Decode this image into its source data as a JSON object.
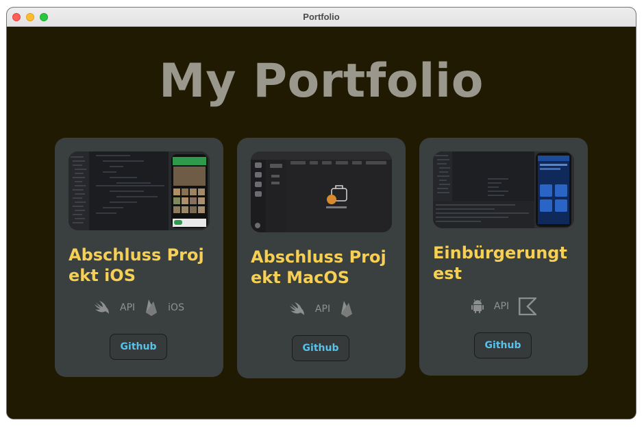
{
  "window": {
    "title": "Portfolio"
  },
  "page": {
    "title": "My Portfolio"
  },
  "projects": [
    {
      "title": "Abschluss Projekt iOS",
      "tech": [
        {
          "icon": "swift-icon"
        },
        {
          "label": "API"
        },
        {
          "icon": "firebase-icon"
        },
        {
          "label": "iOS"
        }
      ],
      "button_label": "Github"
    },
    {
      "title": "Abschluss Projekt MacOS",
      "tech": [
        {
          "icon": "swift-icon"
        },
        {
          "label": "API"
        },
        {
          "icon": "firebase-icon"
        }
      ],
      "button_label": "Github"
    },
    {
      "title": "Einbürgerungtest",
      "tech": [
        {
          "icon": "android-icon"
        },
        {
          "label": "API"
        },
        {
          "icon": "kotlin-icon"
        }
      ],
      "button_label": "Github"
    }
  ],
  "colors": {
    "background": "#201a03",
    "card": "#3a3f3f",
    "project_title": "#f6cf55",
    "page_title": "#9a978d",
    "button_text": "#57c3ec"
  }
}
